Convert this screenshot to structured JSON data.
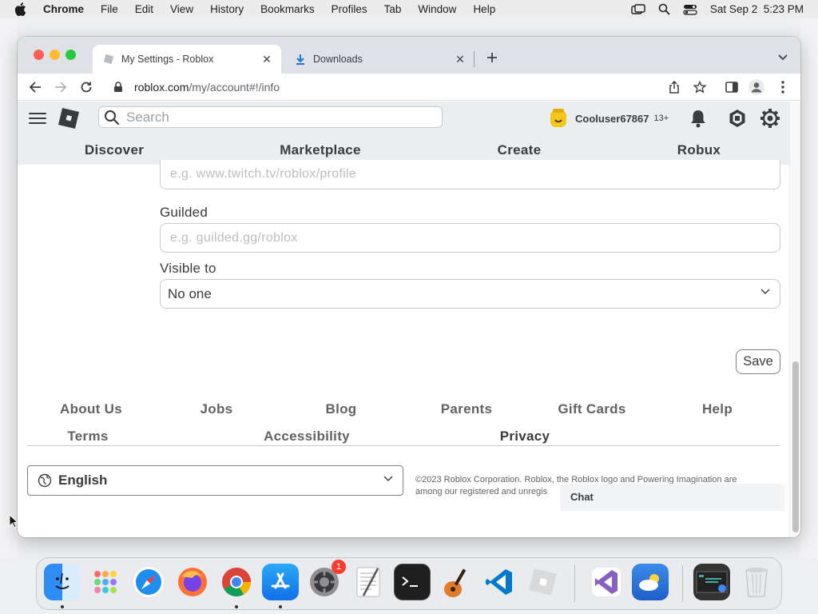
{
  "menubar": {
    "app_name": "Chrome",
    "items": [
      "File",
      "Edit",
      "View",
      "History",
      "Bookmarks",
      "Profiles",
      "Tab",
      "Window",
      "Help"
    ],
    "clock": "Sat Sep 2  5:23 PM"
  },
  "browser": {
    "tabs": [
      {
        "title": "My Settings - Roblox",
        "active": true
      },
      {
        "title": "Downloads",
        "active": false
      }
    ],
    "url_host": "roblox.com",
    "url_path": "/my/account#!/info"
  },
  "roblox": {
    "search_placeholder": "Search",
    "username": "Cooluser67867",
    "age_badge": "13+",
    "nav": [
      "Discover",
      "Marketplace",
      "Create",
      "Robux"
    ]
  },
  "form": {
    "twitch_placeholder": "e.g. www.twitch.tv/roblox/profile",
    "guilded_label": "Guilded",
    "guilded_placeholder": "e.g. guilded.gg/roblox",
    "visible_label": "Visible to",
    "visible_value": "No one",
    "save_label": "Save"
  },
  "footer": {
    "links_row1": [
      "About Us",
      "Jobs",
      "Blog",
      "Parents",
      "Gift Cards",
      "Help"
    ],
    "links_row2": [
      "Terms",
      "Accessibility",
      "Privacy"
    ],
    "language": "English",
    "copyright_line1": "©2023 Roblox Corporation. Roblox, the Roblox logo and Powering Imagination are",
    "copyright_line2": "among our registered and unregis"
  },
  "chat": {
    "label": "Chat"
  },
  "dock": {
    "apps": [
      "finder",
      "launchpad",
      "safari",
      "firefox",
      "chrome",
      "app-store",
      "system-settings",
      "textedit",
      "terminal",
      "garageband",
      "vscode",
      "roblox-studio",
      "visual-studio",
      "weather",
      "screenshot-preview",
      "trash"
    ],
    "settings_badge": "1"
  },
  "colors": {
    "roblox_header_bg": "#ebeef0",
    "text_primary": "#393b3d",
    "close_red": "#ff5f57",
    "minimize_yellow": "#febc2e",
    "zoom_green": "#28c840"
  }
}
